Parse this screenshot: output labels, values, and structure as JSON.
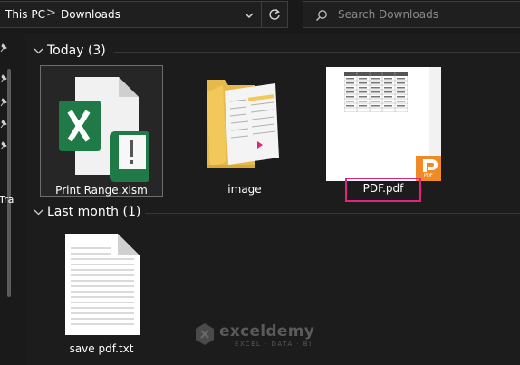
{
  "address_bar": {
    "breadcrumb": [
      "This PC",
      "Downloads"
    ],
    "separator": ">"
  },
  "search": {
    "placeholder": "Search Downloads"
  },
  "nav": {
    "partial_label": "Tra"
  },
  "groups": [
    {
      "title": "Today (3)",
      "files": [
        {
          "name": "Print Range.xlsm",
          "icon": "excel-macro-file-icon",
          "selected": true
        },
        {
          "name": "image",
          "icon": "folder-icon",
          "selected": false
        },
        {
          "name": "PDF.pdf",
          "icon": "pdf-thumbnail-icon",
          "selected": false,
          "highlighted": true,
          "badge": "PDF"
        }
      ]
    },
    {
      "title": "Last month (1)",
      "files": [
        {
          "name": "save pdf.txt",
          "icon": "text-file-icon",
          "selected": false
        }
      ]
    }
  ],
  "watermark": {
    "name": "exceldemy",
    "tagline": "EXCEL · DATA · BI"
  },
  "colors": {
    "background": "#1c1c1c",
    "excel_green": "#1f7a48",
    "folder_yellow": "#f2c85b",
    "pdf_orange": "#f08a24",
    "highlight_pink": "#e0237c"
  }
}
